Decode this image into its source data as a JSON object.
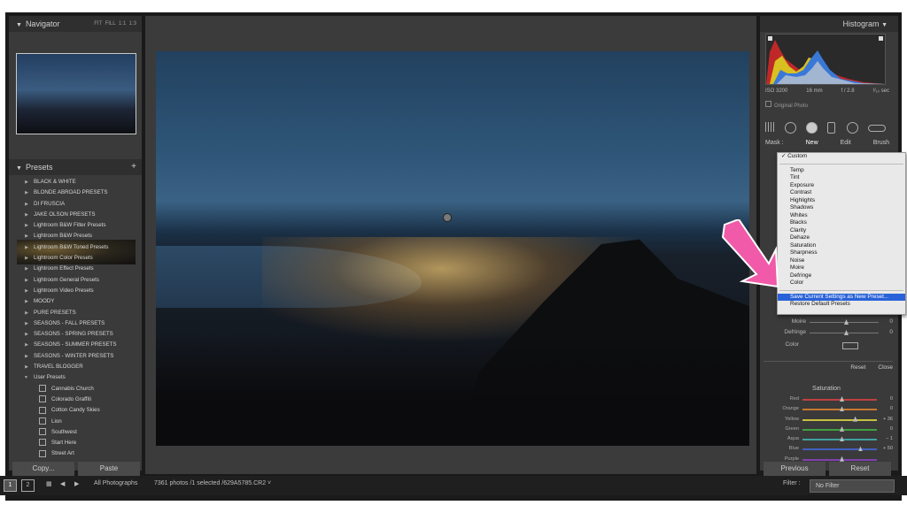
{
  "left": {
    "navigator_title": "Navigator",
    "zoom_options": [
      "FIT",
      "FILL",
      "1:1",
      "1:3"
    ],
    "presets_title": "Presets",
    "add_symbol": "+",
    "presets": [
      {
        "label": "BLACK & WHITE",
        "expanded": false
      },
      {
        "label": "BLONDE ABROAD PRESETS",
        "expanded": false
      },
      {
        "label": "DI FRUSCIA",
        "expanded": false
      },
      {
        "label": "JAKE OLSON PRESETS",
        "expanded": false
      },
      {
        "label": "Lightroom B&W Filter Presets",
        "expanded": false
      },
      {
        "label": "Lightroom B&W Presets",
        "expanded": false
      },
      {
        "label": "Lightroom B&W Toned Presets",
        "expanded": false
      },
      {
        "label": "Lightroom Color Presets",
        "expanded": false
      },
      {
        "label": "Lightroom Effect Presets",
        "expanded": false
      },
      {
        "label": "Lightroom General Presets",
        "expanded": false
      },
      {
        "label": "Lightroom Video Presets",
        "expanded": false
      },
      {
        "label": "MOODY",
        "expanded": false
      },
      {
        "label": "PURE PRESETS",
        "expanded": false
      },
      {
        "label": "SEASONS - FALL PRESETS",
        "expanded": false
      },
      {
        "label": "SEASONS - SPRING PRESETS",
        "expanded": false
      },
      {
        "label": "SEASONS - SUMMER PRESETS",
        "expanded": false
      },
      {
        "label": "SEASONS - WINTER PRESETS",
        "expanded": false
      },
      {
        "label": "TRAVEL BLOGGER",
        "expanded": false
      },
      {
        "label": "User Presets",
        "expanded": true
      }
    ],
    "user_presets": [
      "Cannabis Church",
      "Colorado Graffiti",
      "Cotton Candy Skies",
      "Lion",
      "Southwest",
      "Start Here",
      "Street Art"
    ],
    "copy_label": "Copy...",
    "paste_label": "Paste"
  },
  "right": {
    "histogram_title": "Histogram",
    "exif": [
      "ISO 3200",
      "16 mm",
      "f / 2.8",
      "¹⁄₁₀ sec"
    ],
    "original_photo": "Original Photo",
    "mask_label": "Mask :",
    "mask_new": "New",
    "mask_edit": "Edit",
    "mask_brush": "Brush",
    "adj_rows": [
      {
        "label": "Moire",
        "value": "0",
        "pos": 0.5
      },
      {
        "label": "Defringe",
        "value": "0",
        "pos": 0.5
      }
    ],
    "color_label": "Color",
    "reset_label": "Reset",
    "close_label": "Close",
    "saturation_title": "Saturation",
    "saturation": [
      {
        "label": "Red",
        "value": "0",
        "pos": 0.5,
        "color": "#c04040"
      },
      {
        "label": "Orange",
        "value": "0",
        "pos": 0.5,
        "color": "#c87a30"
      },
      {
        "label": "Yellow",
        "value": "+ 36",
        "pos": 0.68,
        "color": "#c8c040"
      },
      {
        "label": "Green",
        "value": "0",
        "pos": 0.5,
        "color": "#40a040"
      },
      {
        "label": "Aqua",
        "value": "− 1",
        "pos": 0.5,
        "color": "#40a0a0"
      },
      {
        "label": "Blue",
        "value": "+ 50",
        "pos": 0.75,
        "color": "#4060c0"
      },
      {
        "label": "Purple",
        "value": "",
        "pos": 0.5,
        "color": "#8040b0"
      }
    ],
    "previous_label": "Previous",
    "reset_btn_label": "Reset"
  },
  "dropdown": {
    "checked": "Custom",
    "items": [
      "Temp",
      "Tint",
      "Exposure",
      "Contrast",
      "Highlights",
      "Shadows",
      "Whites",
      "Blacks",
      "Clarity",
      "Dehaze",
      "Saturation",
      "Sharpness",
      "Noise",
      "Moire",
      "Defringe",
      "Color"
    ],
    "save": "Save Current Settings as New Preset...",
    "restore": "Restore Default Presets"
  },
  "bottom": {
    "page1": "1",
    "page2": "2",
    "source": "All Photographs",
    "status": "7361 photos /1 selected /629A5785.CR2 ˅",
    "filter_label": "Filter :",
    "filter_value": "No Filter"
  },
  "colors": {
    "accent_arrow": "#f05aa8",
    "selection": "#2962d8"
  }
}
